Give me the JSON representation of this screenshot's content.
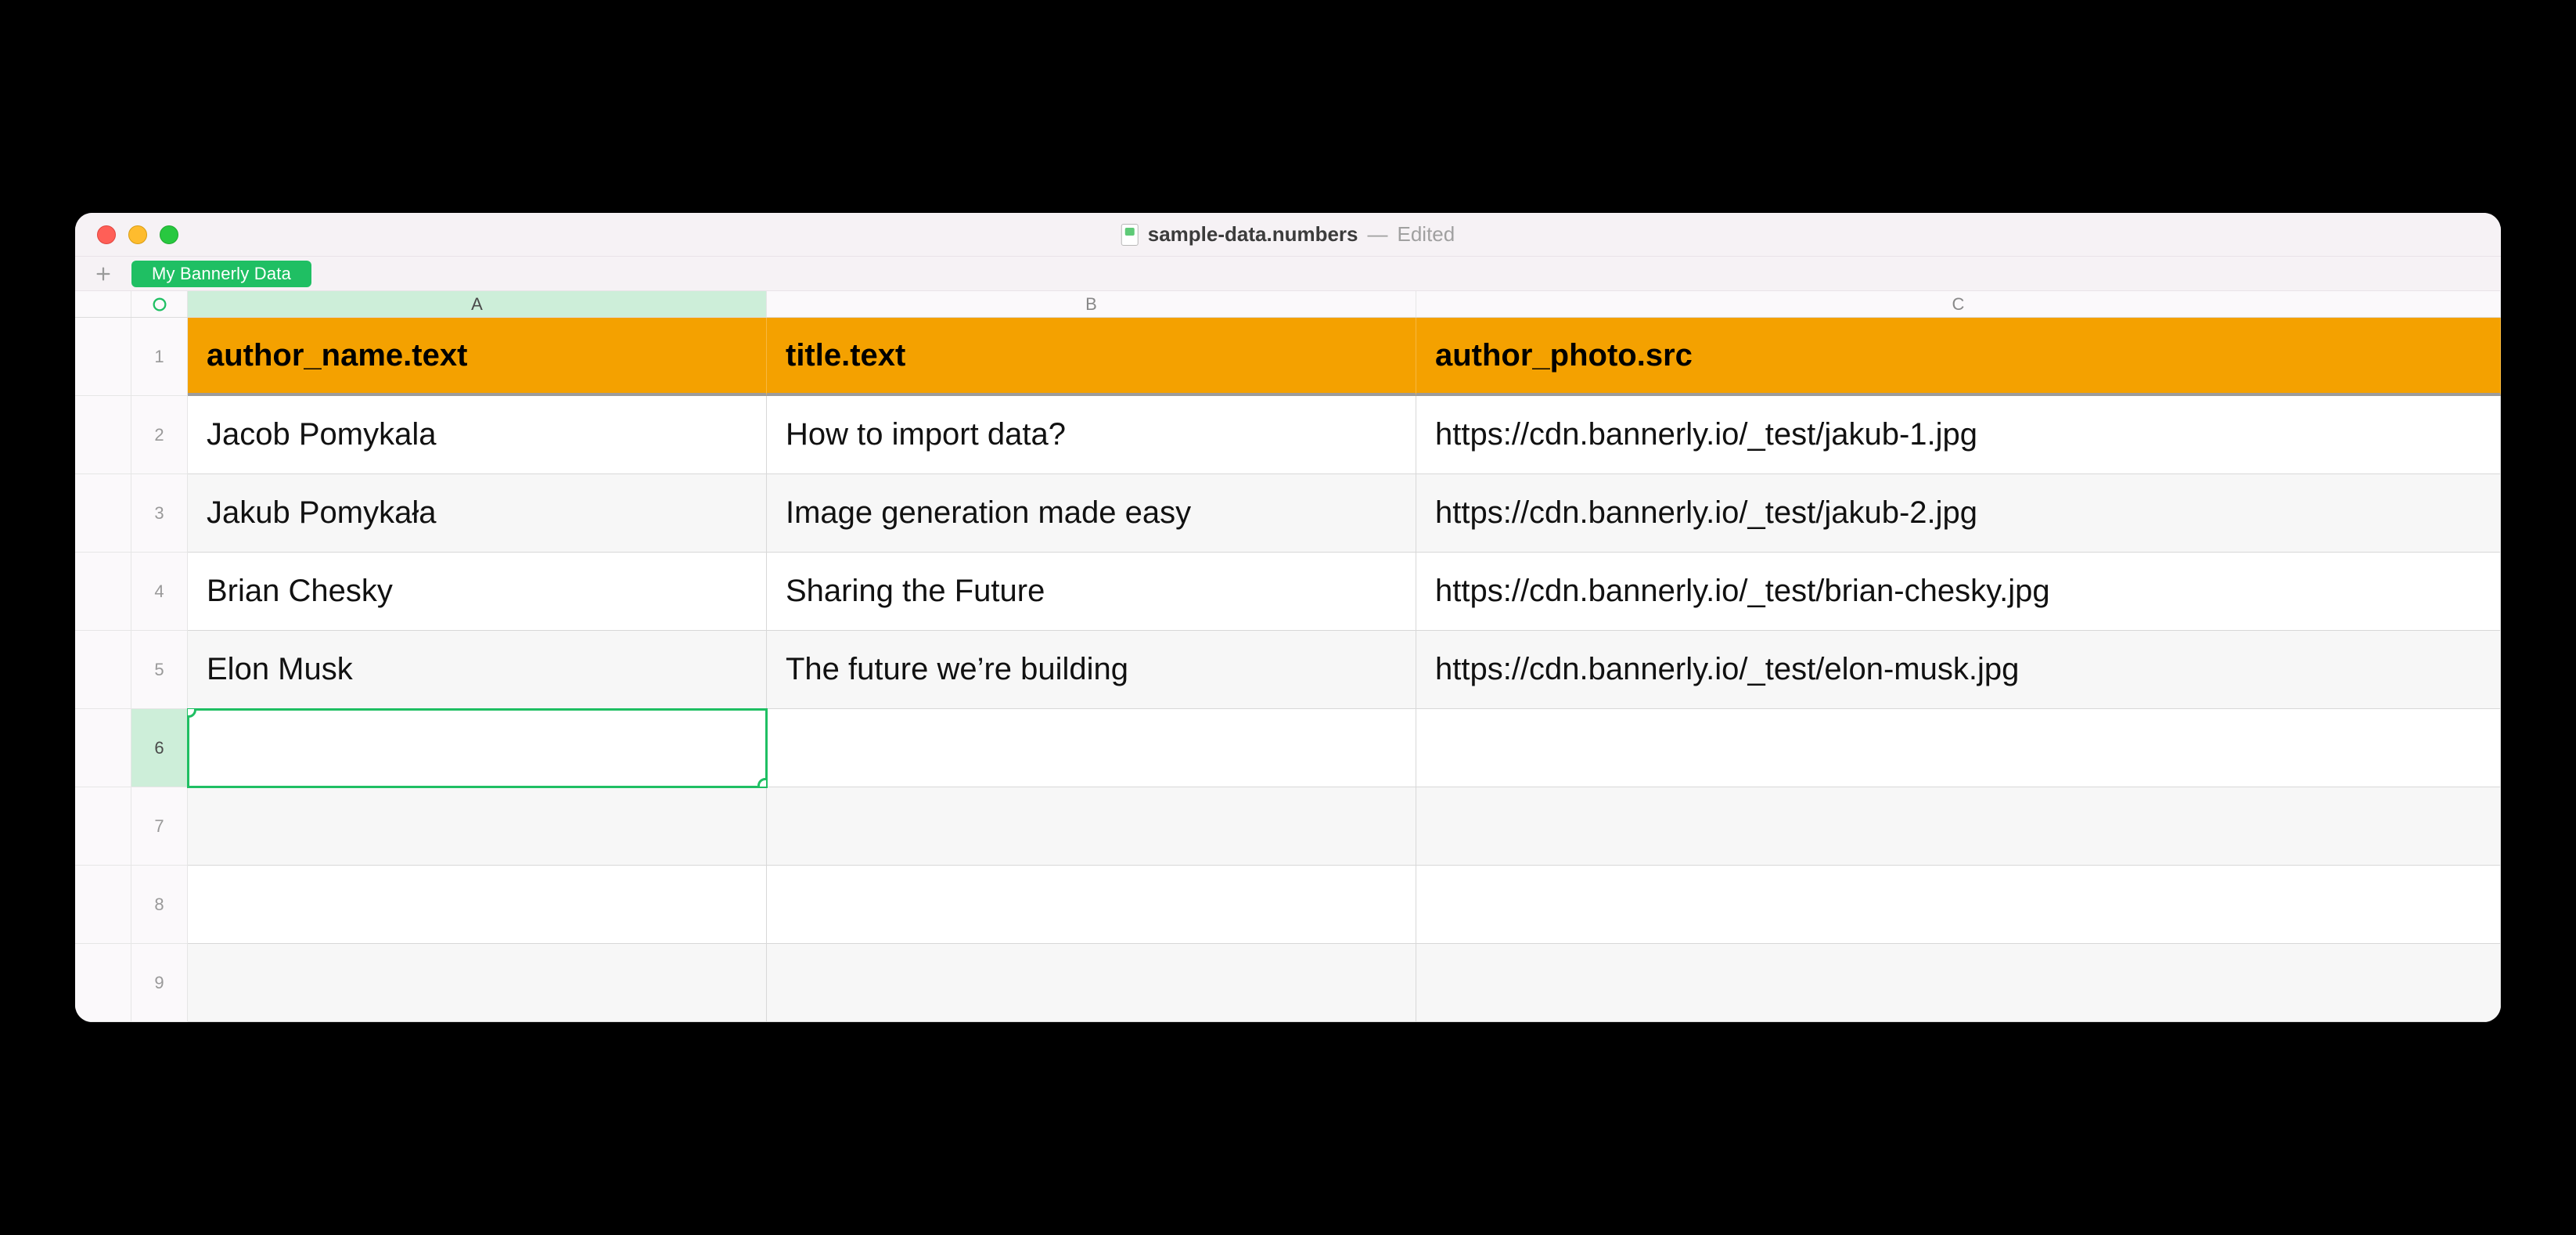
{
  "window": {
    "filename": "sample-data.numbers",
    "status": "Edited"
  },
  "sheetbar": {
    "active_tab": "My Bannerly Data"
  },
  "columns": {
    "labels": [
      "A",
      "B",
      "C"
    ],
    "active_index": 0
  },
  "table": {
    "headers": [
      "author_name.text",
      "title.text",
      "author_photo.src"
    ],
    "rows": [
      {
        "n": "1"
      },
      {
        "n": "2",
        "cells": [
          "Jacob Pomykala",
          "How to import data?",
          "https://cdn.bannerly.io/_test/jakub-1.jpg"
        ]
      },
      {
        "n": "3",
        "cells": [
          "Jakub Pomykała",
          "Image generation made easy",
          "https://cdn.bannerly.io/_test/jakub-2.jpg"
        ]
      },
      {
        "n": "4",
        "cells": [
          "Brian Chesky",
          "Sharing the Future",
          "https://cdn.bannerly.io/_test/brian-chesky.jpg"
        ]
      },
      {
        "n": "5",
        "cells": [
          "Elon Musk",
          "The future we’re building",
          "https://cdn.bannerly.io/_test/elon-musk.jpg"
        ]
      },
      {
        "n": "6",
        "cells": [
          "",
          "",
          ""
        ]
      },
      {
        "n": "7",
        "cells": [
          "",
          "",
          ""
        ]
      },
      {
        "n": "8",
        "cells": [
          "",
          "",
          ""
        ]
      },
      {
        "n": "9",
        "cells": [
          "",
          "",
          ""
        ]
      }
    ],
    "selected": {
      "row": 6,
      "col": 0
    },
    "active_row": 6
  }
}
